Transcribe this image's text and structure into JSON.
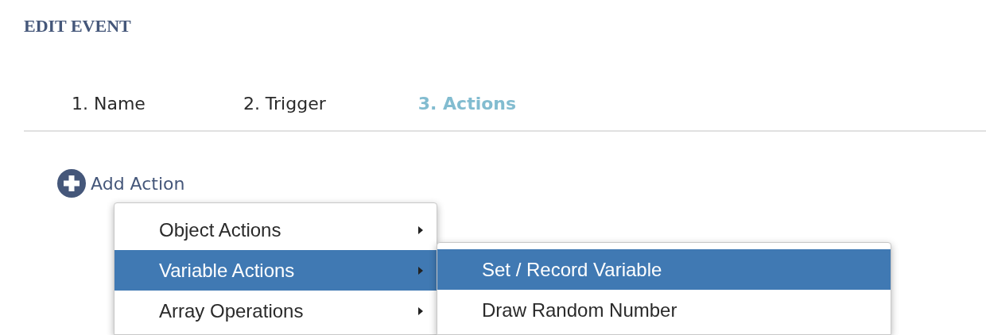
{
  "title": "EDIT EVENT",
  "steps": [
    {
      "label": "1. Name",
      "selected": false
    },
    {
      "label": "2. Trigger",
      "selected": false
    },
    {
      "label": "3. Actions",
      "selected": true
    }
  ],
  "add_button": {
    "label": "Add Action"
  },
  "menu": {
    "items": [
      {
        "label": "Object Actions",
        "selected": false,
        "has_submenu": true
      },
      {
        "label": "Variable Actions",
        "selected": true,
        "has_submenu": true
      },
      {
        "label": "Array Operations",
        "selected": false,
        "has_submenu": true
      }
    ]
  },
  "submenu": {
    "items": [
      {
        "label": "Set / Record Variable",
        "selected": true,
        "has_submenu": false
      },
      {
        "label": "Draw Random Number",
        "selected": false,
        "has_submenu": false
      }
    ]
  }
}
